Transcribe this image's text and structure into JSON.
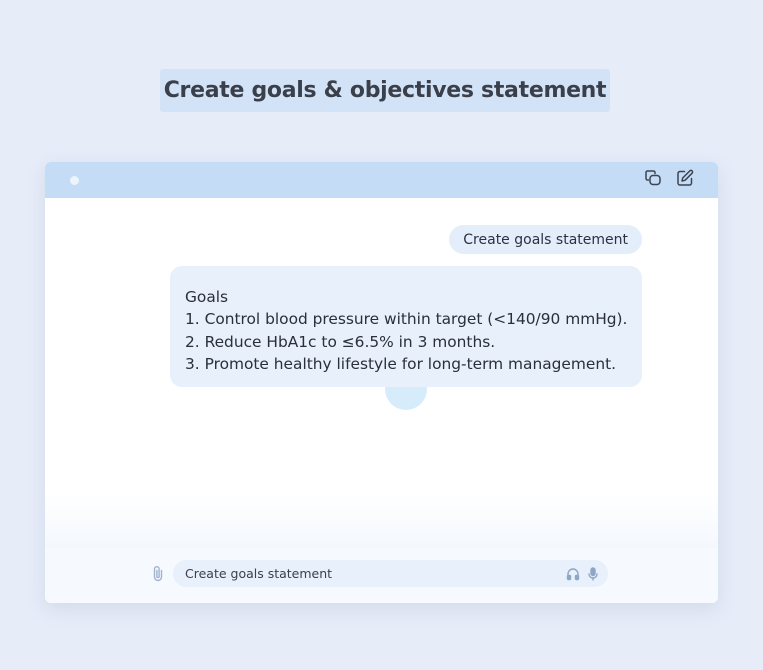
{
  "page": {
    "title": "Create goals & objectives statement"
  },
  "toolbar": {
    "icons": [
      "copy-chat-icon",
      "edit-icon"
    ]
  },
  "chat": {
    "user_message": "Create goals statement",
    "response": {
      "heading": "Goals",
      "items": [
        "1. Control blood pressure within target (<140/90 mmHg).",
        "2. Reduce HbA1c to ≤6.5% in 3 months.",
        "3. Promote healthy lifestyle for long-term management."
      ]
    }
  },
  "composer": {
    "value": "Create goals statement",
    "icons": [
      "paperclip-icon",
      "headphones-icon",
      "microphone-icon"
    ]
  },
  "colors": {
    "background": "#e6ecf8",
    "title_bg": "#d3e3f7",
    "titlebar": "#c4dcf5",
    "bubble": "#e8f0fc",
    "icon": "#3d4350",
    "muted_icon": "#9fb3cf"
  }
}
